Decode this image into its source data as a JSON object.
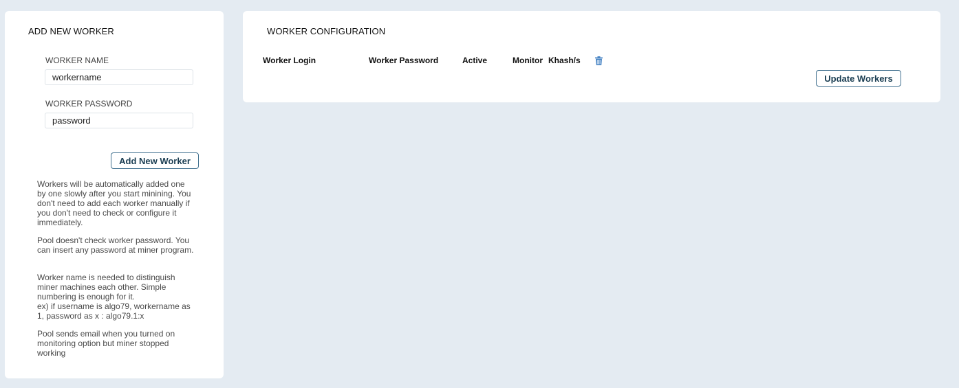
{
  "add_worker": {
    "title": "ADD NEW WORKER",
    "name_label": "WORKER NAME",
    "name_value": "workername",
    "password_label": "WORKER PASSWORD",
    "password_value": "password",
    "add_button": "Add New Worker",
    "help": [
      "Workers will be automatically added one by one slowly after you start minining. You don't need to add each worker manually if you don't need to check or configure it immediately.",
      "Pool doesn't check worker password. You can insert any password at miner program.",
      "Worker name is needed to distinguish miner machines each other. Simple numbering is enough for it.",
      "ex) if username is algo79, workername as 1, password as x : algo79.1:x",
      "Pool sends email when you turned on monitoring option but miner stopped working"
    ]
  },
  "worker_config": {
    "title": "WORKER CONFIGURATION",
    "columns": {
      "login": "Worker Login",
      "password": "Worker Password",
      "active": "Active",
      "monitor": "Monitor",
      "hashrate": "Khash/s"
    },
    "delete_icon": "trash-icon",
    "update_button": "Update Workers"
  },
  "colors": {
    "background": "#e4ebf2",
    "button_border": "#3f6f8e",
    "icon": "#4a86c5"
  }
}
